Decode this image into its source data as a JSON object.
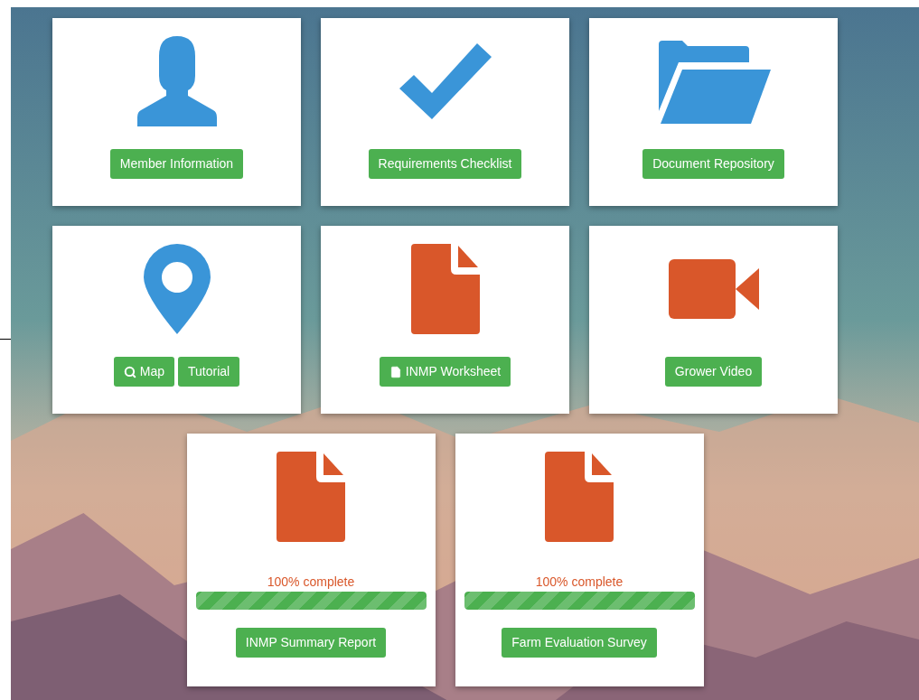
{
  "cards": [
    {
      "kind": "person",
      "buttons": [
        {
          "label": "Member Information"
        }
      ]
    },
    {
      "kind": "check",
      "buttons": [
        {
          "label": "Requirements Checklist"
        }
      ]
    },
    {
      "kind": "folder",
      "buttons": [
        {
          "label": "Document Repository"
        }
      ]
    },
    {
      "kind": "pin",
      "buttons": [
        {
          "label": "Map",
          "kind": "search"
        },
        {
          "label": "Tutorial"
        }
      ]
    },
    {
      "kind": "file",
      "buttons": [
        {
          "label": "INMP Worksheet",
          "kind": "file"
        }
      ]
    },
    {
      "kind": "video",
      "buttons": [
        {
          "label": "Grower Video"
        }
      ]
    },
    {
      "kind": "file",
      "progress": {
        "text": "100% complete",
        "level": 1
      },
      "buttons": [
        {
          "label": "INMP Summary Report"
        }
      ]
    },
    {
      "kind": "file",
      "progress": {
        "text": "100% complete",
        "level": 1
      },
      "buttons": [
        {
          "label": "Farm Evaluation Survey"
        }
      ]
    }
  ]
}
